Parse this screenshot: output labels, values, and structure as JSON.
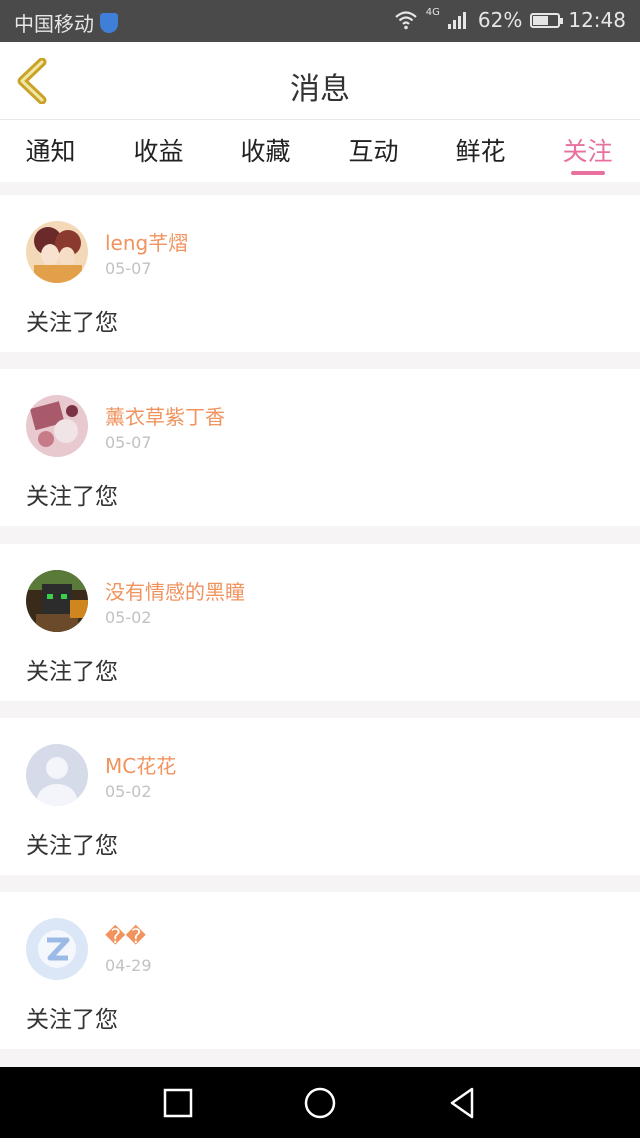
{
  "status_bar": {
    "carrier": "中国移动",
    "network": "4G",
    "battery": "62%",
    "battery_level": 0.62,
    "time": "12:48"
  },
  "header": {
    "title": "消息"
  },
  "tabs": [
    {
      "label": "通知",
      "active": false
    },
    {
      "label": "收益",
      "active": false
    },
    {
      "label": "收藏",
      "active": false
    },
    {
      "label": "互动",
      "active": false
    },
    {
      "label": "鲜花",
      "active": false
    },
    {
      "label": "关注",
      "active": true
    }
  ],
  "messages": [
    {
      "name": "leng芊熠",
      "date": "05-07",
      "text": "关注了您"
    },
    {
      "name": "薰衣草紫丁香",
      "date": "05-07",
      "text": "关注了您"
    },
    {
      "name": "没有情感的黑瞳",
      "date": "05-02",
      "text": "关注了您"
    },
    {
      "name": "MC花花",
      "date": "05-02",
      "text": "关注了您"
    },
    {
      "name": "��",
      "date": "04-29",
      "text": "关注了您"
    }
  ],
  "colors": {
    "accent": "#e8709e",
    "username": "#f0935e",
    "back_arrow": "#c9a227"
  },
  "icons": {
    "back": "chevron-left-icon",
    "nav_recent": "square-icon",
    "nav_home": "circle-icon",
    "nav_back": "triangle-back-icon"
  }
}
